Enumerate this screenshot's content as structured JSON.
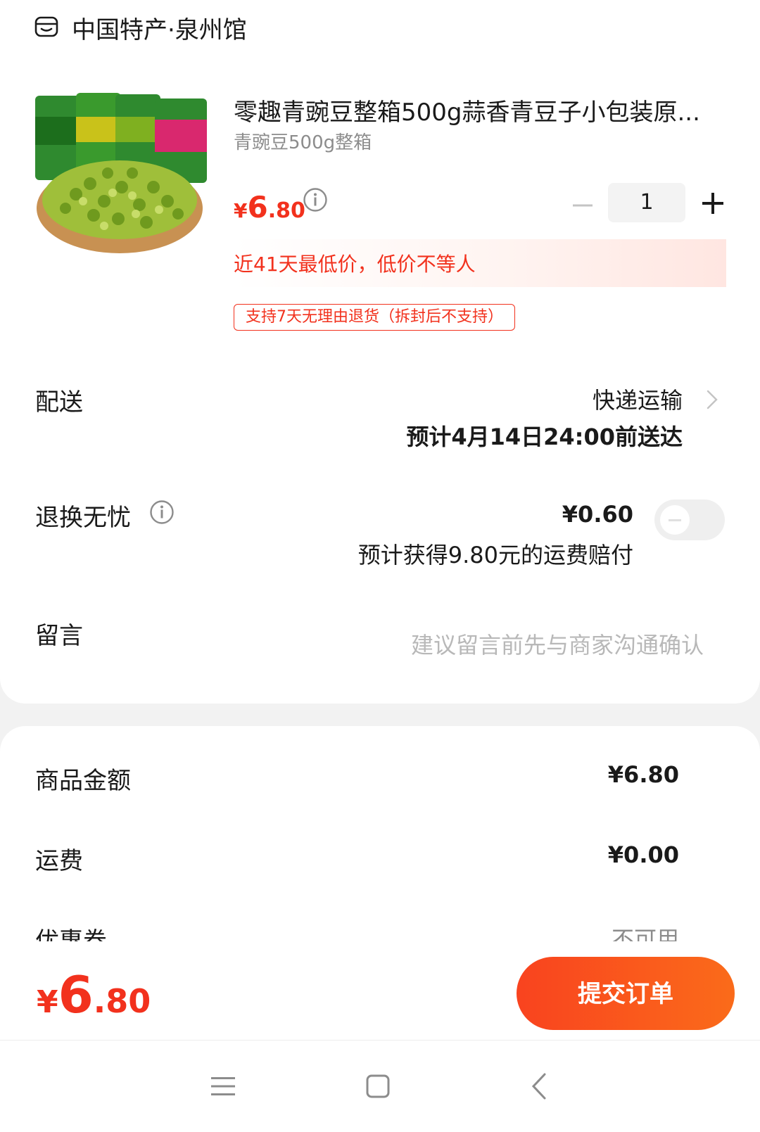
{
  "shop": {
    "name": "中国特产·泉州馆",
    "icon": "store-icon"
  },
  "product": {
    "title": "零趣青豌豆整箱500g蒜香青豆子小包装原...",
    "spec": "青豌豆500g整箱",
    "price": {
      "currency": "¥",
      "integer": "6",
      "decimal": ".80"
    },
    "quantity": "1",
    "lowest_price_note": "近41天最低价，低价不等人",
    "return_tag": "支持7天无理由退货（拆封后不支持）"
  },
  "delivery": {
    "label": "配送",
    "method": "快递运输",
    "eta": "预计4月14日24:00前送达"
  },
  "return_insurance": {
    "label": "退换无忧",
    "price": "¥0.60",
    "desc": "预计获得9.80元的运费赔付",
    "enabled": false
  },
  "message": {
    "label": "留言",
    "placeholder": "建议留言前先与商家沟通确认"
  },
  "summary": {
    "goods_label": "商品金额",
    "goods_value": "¥6.80",
    "shipping_label": "运费",
    "shipping_value": "¥0.00",
    "coupon_label": "优惠券",
    "coupon_value": "不可用"
  },
  "footer": {
    "total": {
      "currency": "¥",
      "integer": "6",
      "decimal": ".80"
    },
    "submit_label": "提交订单"
  },
  "colors": {
    "accent": "#f2311d",
    "button_start": "#f9431f",
    "button_end": "#fa6b1a"
  }
}
